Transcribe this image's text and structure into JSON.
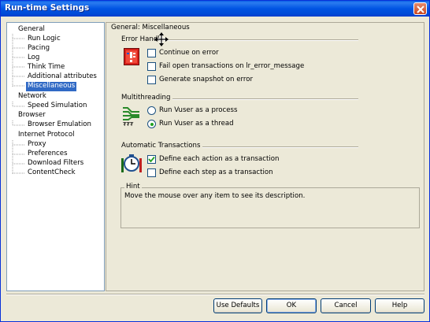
{
  "window": {
    "title": "Run-time Settings"
  },
  "tree": {
    "items": [
      {
        "label": "General",
        "level": 0,
        "selected": false
      },
      {
        "label": "Run Logic",
        "level": 1,
        "selected": false
      },
      {
        "label": "Pacing",
        "level": 1,
        "selected": false
      },
      {
        "label": "Log",
        "level": 1,
        "selected": false
      },
      {
        "label": "Think Time",
        "level": 1,
        "selected": false
      },
      {
        "label": "Additional attributes",
        "level": 1,
        "selected": false
      },
      {
        "label": "Miscellaneous",
        "level": 1,
        "selected": true
      },
      {
        "label": "Network",
        "level": 0,
        "selected": false
      },
      {
        "label": "Speed Simulation",
        "level": 1,
        "selected": false
      },
      {
        "label": "Browser",
        "level": 0,
        "selected": false
      },
      {
        "label": "Browser Emulation",
        "level": 1,
        "selected": false
      },
      {
        "label": "Internet Protocol",
        "level": 0,
        "selected": false
      },
      {
        "label": "Proxy",
        "level": 1,
        "selected": false
      },
      {
        "label": "Preferences",
        "level": 1,
        "selected": false
      },
      {
        "label": "Download Filters",
        "level": 1,
        "selected": false
      },
      {
        "label": "ContentCheck",
        "level": 1,
        "selected": false
      }
    ]
  },
  "panel": {
    "title": "General: Miscellaneous",
    "error_handling": {
      "title": "Error Handli",
      "options": [
        {
          "label": "Continue on error",
          "checked": false
        },
        {
          "label": "Fail open transactions on lr_error_message",
          "checked": false
        },
        {
          "label": "Generate snapshot on error",
          "checked": false
        }
      ]
    },
    "multithreading": {
      "title": "Multithreading",
      "options": [
        {
          "label": "Run Vuser as a process",
          "selected": false
        },
        {
          "label": "Run Vuser as a thread",
          "selected": true
        }
      ]
    },
    "automatic_transactions": {
      "title": "Automatic Transactions",
      "options": [
        {
          "label": "Define each action as a transaction",
          "checked": true
        },
        {
          "label": "Define each step as a transaction",
          "checked": false
        }
      ]
    },
    "hint": {
      "title": "Hint",
      "text": "Move the mouse over any item to see its description."
    }
  },
  "buttons": {
    "use_defaults": "Use Defaults",
    "ok": "OK",
    "cancel": "Cancel",
    "help": "Help"
  },
  "colors": {
    "titlebar": "#0054e3",
    "selection": "#316ac5",
    "face": "#ece9d8"
  }
}
